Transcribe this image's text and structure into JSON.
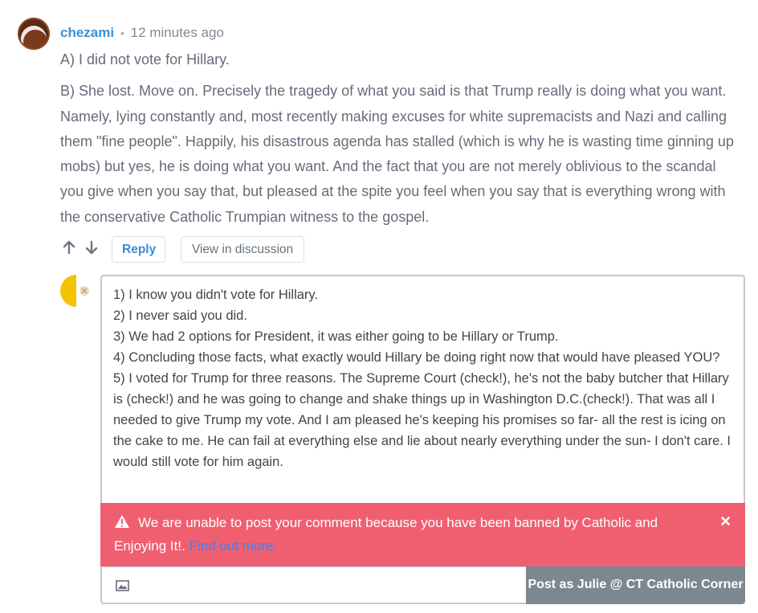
{
  "comment": {
    "author": "chezami",
    "bullet": "•",
    "time": "12 minutes ago",
    "paragraphs": [
      "A) I did not vote for Hillary.",
      "B) She lost. Move on. Precisely the tragedy of what you said is that Trump really is doing what you want. Namely, lying constantly and, most recently making excuses for white supremacists and Nazi and calling them \"fine people\". Happily, his disastrous agenda has stalled (which is why he is wasting time ginning up mobs) but yes, he is doing what you want. And the fact that you are not merely oblivious to the scandal you give when you say that, but pleased at the spite you feel when you say that is everything wrong with the conservative Catholic Trumpian witness to the gospel."
    ],
    "upvote_icon": "arrow-up-icon",
    "downvote_icon": "arrow-down-icon",
    "reply_label": "Reply",
    "view_label": "View in discussion"
  },
  "reply_box": {
    "lines": [
      "1) I know you didn't vote for Hillary.",
      "2) I never said you did.",
      "3) We had 2 options for President, it was either going to be Hillary or Trump.",
      "4) Concluding those facts, what exactly would Hillary be doing right now that would have pleased YOU?",
      "5) I voted for Trump for three reasons. The Supreme Court (check!), he's not the baby butcher that Hillary is (check!) and he was going to change and shake things up in Washington D.C.(check!). That was all I needed to give Trump my vote. And I am pleased he's keeping his promises so far- all the rest is icing on the cake to me. He can fail at everything else and lie about nearly everything under the sun- I don't care.  I would still vote for him again."
    ],
    "alert_text": "We are unable to post your comment because you have been banned by Catholic and Enjoying It!. ",
    "alert_link": "Find out more.",
    "close_symbol": "×",
    "post_label": "Post as Julie @ CT Catholic Corner"
  },
  "colors": {
    "author": "#3d8fd1",
    "alert_bg": "#f05f70",
    "post_button": "#7b8890"
  }
}
